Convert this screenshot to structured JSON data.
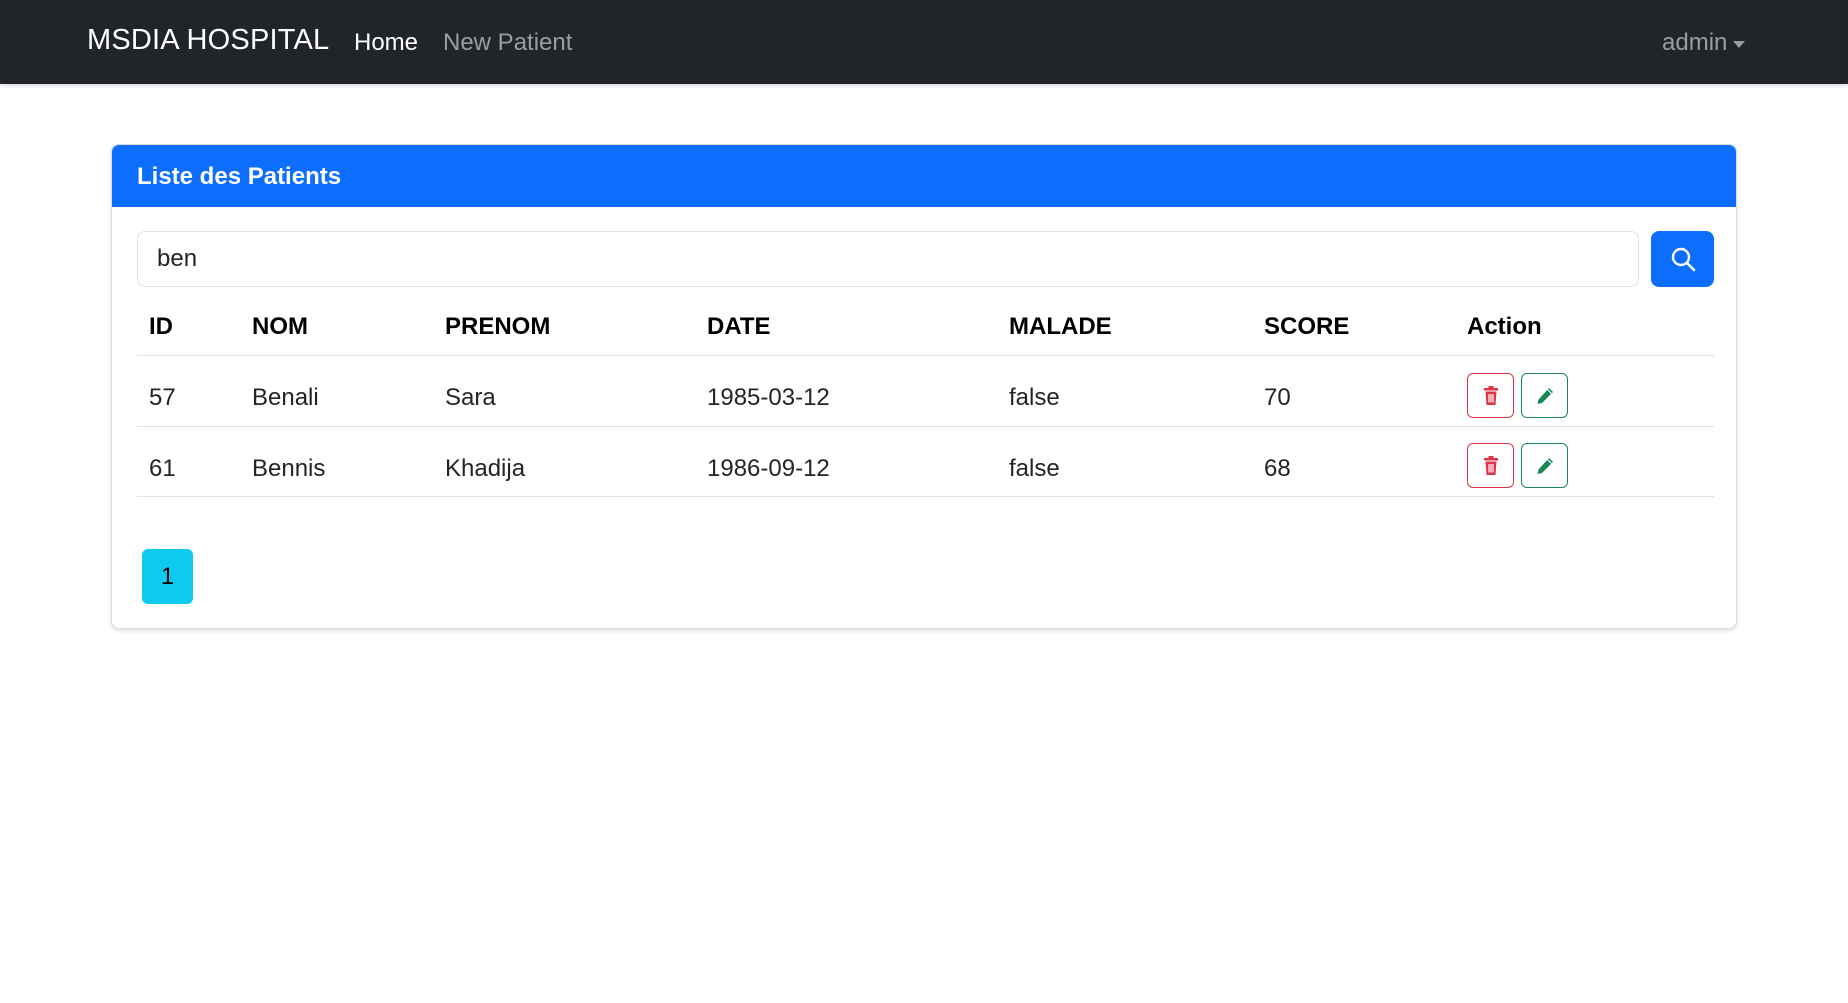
{
  "navbar": {
    "brand": "MSDIA HOSPITAL",
    "links": [
      {
        "label": "Home",
        "active": true
      },
      {
        "label": "New Patient",
        "active": false
      }
    ],
    "user": "admin"
  },
  "card": {
    "title": "Liste des Patients",
    "search": {
      "value": "ben",
      "button_icon": "search-icon"
    },
    "table": {
      "headers": [
        "ID",
        "NOM",
        "PRENOM",
        "DATE",
        "MALADE",
        "SCORE",
        "Action"
      ],
      "rows": [
        {
          "id": "57",
          "nom": "Benali",
          "prenom": "Sara",
          "date": "1985-03-12",
          "malade": "false",
          "score": "70"
        },
        {
          "id": "61",
          "nom": "Bennis",
          "prenom": "Khadija",
          "date": "1986-09-12",
          "malade": "false",
          "score": "68"
        }
      ],
      "row_actions": [
        "trash-icon",
        "pencil-icon"
      ]
    },
    "pagination": {
      "pages": [
        "1"
      ],
      "current": "1"
    }
  },
  "colors": {
    "navbar_bg": "#212529",
    "primary": "#0d6efd",
    "danger": "#dc3545",
    "success": "#198754",
    "info": "#0dcaf0"
  }
}
